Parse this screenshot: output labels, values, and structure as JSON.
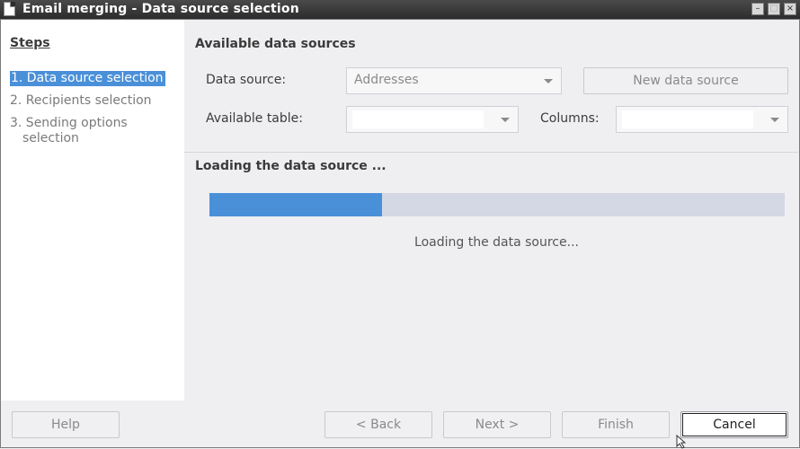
{
  "window": {
    "title": "Email merging - Data source selection",
    "controls": [
      "minimize-icon",
      "maximize-icon",
      "close-icon"
    ]
  },
  "steps": {
    "title": "Steps",
    "items": [
      {
        "label": "1. Data source selection",
        "active": true
      },
      {
        "label": "2. Recipients selection",
        "active": false
      },
      {
        "label": "3. Sending options",
        "active": false
      },
      {
        "label": "selection",
        "active": false
      }
    ]
  },
  "data_sources": {
    "section_title": "Available data sources",
    "data_source_label": "Data source:",
    "data_source_value": "Addresses",
    "new_data_source_label": "New data source",
    "available_table_label": "Available table:",
    "available_table_value": "",
    "columns_label": "Columns:",
    "columns_value": ""
  },
  "loading": {
    "section_title": "Loading the data source ...",
    "progress": 0.3,
    "status_text": "Loading the data source..."
  },
  "buttons": {
    "help": "Help",
    "back": "< Back",
    "next": "Next >",
    "finish": "Finish",
    "cancel": "Cancel"
  },
  "colors": {
    "accent": "#4a90d9",
    "progress_track": "#d3d8e4"
  }
}
